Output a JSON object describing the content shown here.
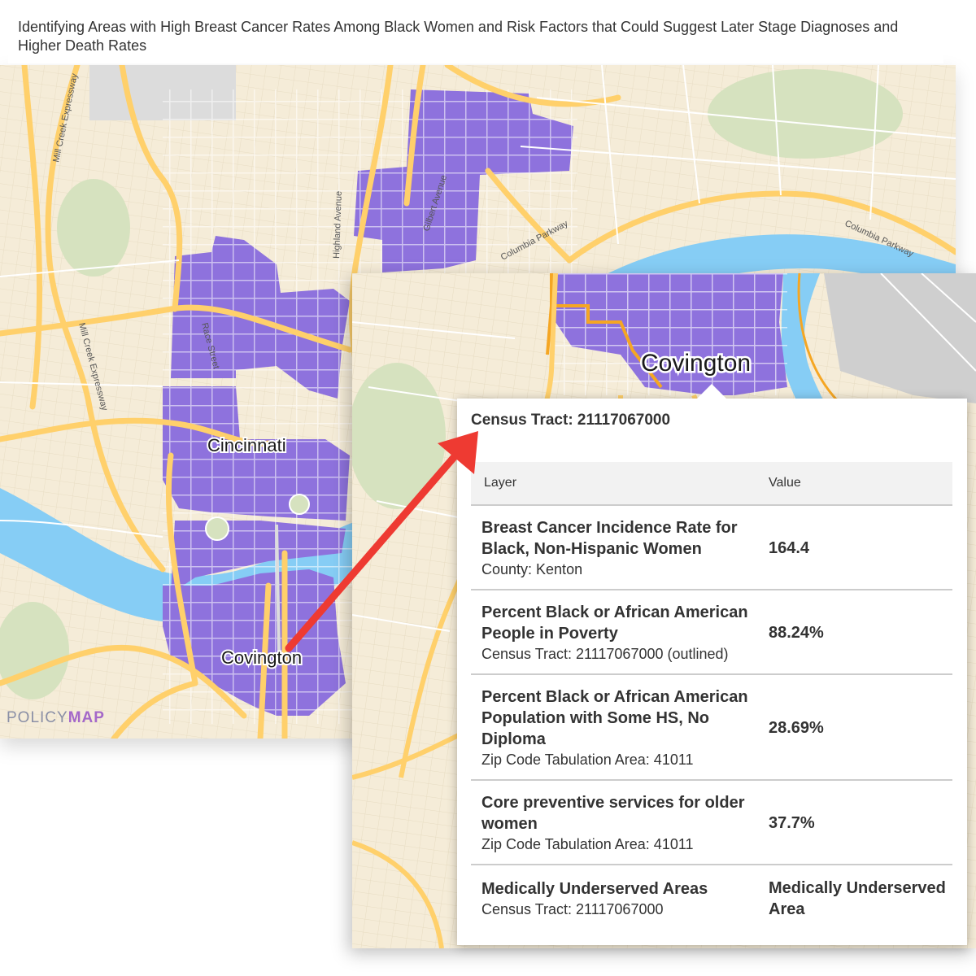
{
  "title": "Identifying Areas with High Breast Cancer Rates Among Black Women and Risk Factors that Could Suggest Later Stage Diagnoses and Higher Death Rates",
  "map": {
    "places": [
      "Cincinnati",
      "Covington"
    ],
    "streets": [
      "Mill Creek Expressway",
      "Mill Creek Expressway",
      "Highland Avenue",
      "Gilbert Avenue",
      "Columbia Parkway",
      "Columbia Parkway",
      "Race Street"
    ],
    "logo_part1": "POLICY",
    "logo_part2": "MAP",
    "colors": {
      "land": "#f5ecd8",
      "water": "#86cdf5",
      "highlight": "#8e72dd",
      "major_road": "#ffd06b",
      "outline": "#f5a623",
      "park": "#d6e2bf"
    }
  },
  "inset": {
    "place": "Covington"
  },
  "popup": {
    "title": "Census Tract: 21117067000",
    "header_layer": "Layer",
    "header_value": "Value",
    "rows": [
      {
        "name": "Breast Cancer Incidence Rate for Black, Non-Hispanic Women",
        "sub": "County: Kenton",
        "value": "164.4"
      },
      {
        "name": "Percent Black or African American People in Poverty",
        "sub": "Census Tract: 21117067000 (outlined)",
        "value": "88.24%"
      },
      {
        "name": "Percent Black or African American Population with Some HS, No Diploma",
        "sub": "Zip Code Tabulation Area: 41011",
        "value": "28.69%"
      },
      {
        "name": "Core preventive services for older women",
        "sub": "Zip Code Tabulation Area: 41011",
        "value": "37.7%"
      },
      {
        "name": "Medically Underserved Areas",
        "sub": "Census Tract: 21117067000",
        "value": "Medically Underserved Area"
      }
    ]
  },
  "arrow_color": "#ee3a32"
}
